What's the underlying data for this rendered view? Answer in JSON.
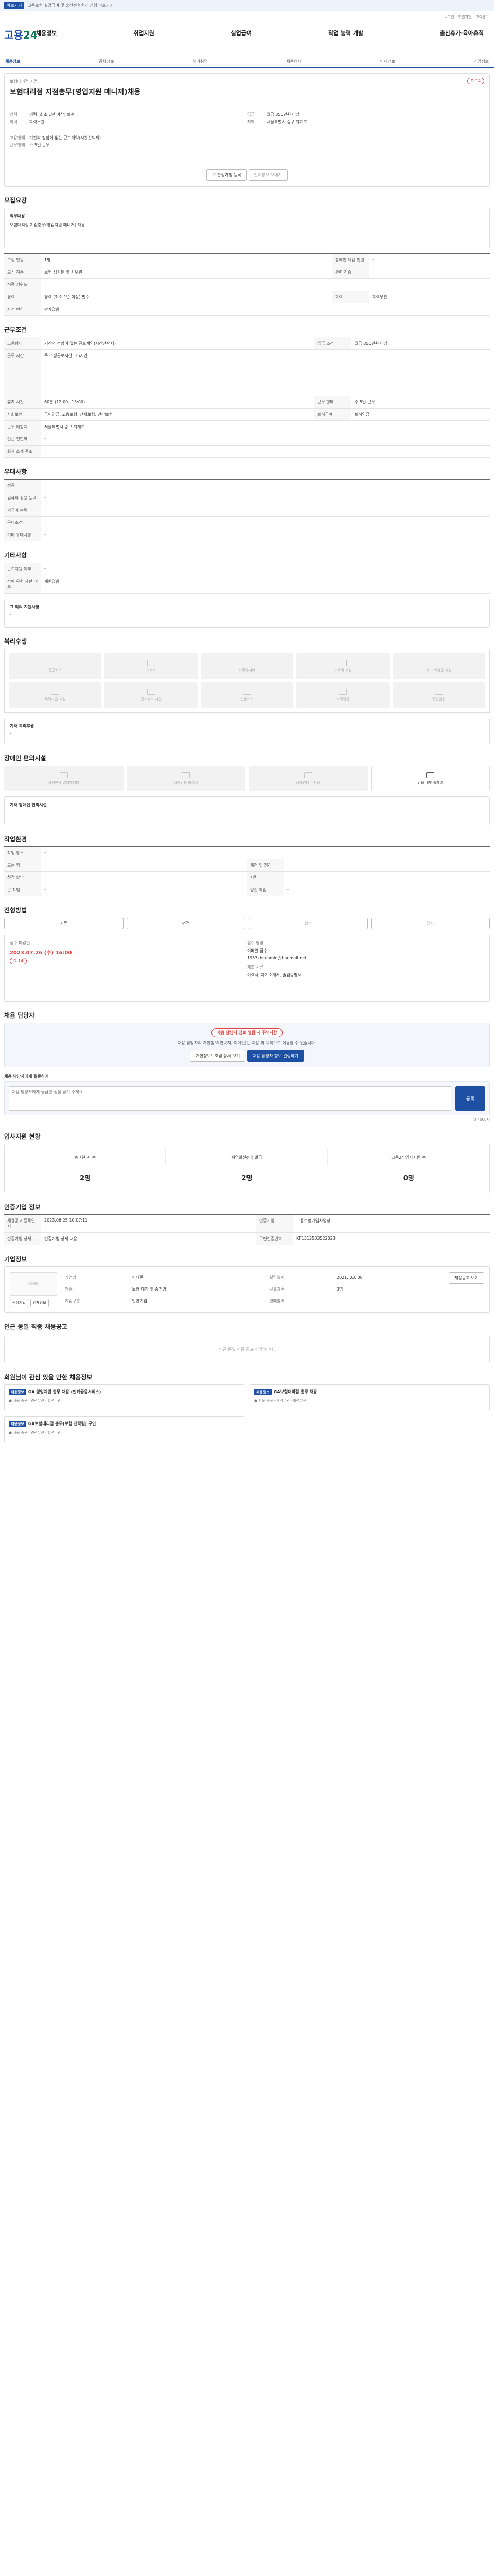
{
  "topbar": {
    "go": "바로가기",
    "text": "고용보험 실업급여 및 출산전후휴가 신청 바로가기"
  },
  "header": {
    "links": [
      "로그인",
      "회원가입",
      "고객센터"
    ],
    "logo_a": "고용",
    "logo_b": "24",
    "gnb": [
      "채용정보",
      "취업지원",
      "실업급여",
      "직업 능력 개발",
      "출산휴가·육아휴직"
    ]
  },
  "subtabs": [
    "채용정보",
    "공채정보",
    "해외취업",
    "채용행사",
    "인재정보",
    "기업정보"
  ],
  "job": {
    "company": "보험대리점 지점",
    "title": "보험대리점 지점충무(영업지원 매니저)채용",
    "dday": "D-14",
    "left": [
      [
        "경력",
        "경력 (최소 1년 이상) 필수"
      ],
      [
        "학력",
        "학력무관"
      ]
    ],
    "right": [
      [
        "임금",
        "월급 350만원 이상"
      ],
      [
        "지역",
        "서울특별시 중구 퇴계로"
      ]
    ],
    "left2": [
      [
        "고용형태",
        "기간의 정함이 없는 근로계약(시간선택제)"
      ],
      [
        "근무형태",
        "주 5일 근무"
      ]
    ],
    "buttons": [
      "관심기업 등록",
      "인재정보 보내기",
      "입사지원"
    ]
  },
  "sections": {
    "recruit": "모집요강",
    "conditions": "근무조건",
    "treatment": "우대사항",
    "others": "기타사항",
    "welfare": "복리후생",
    "disability": "장애인 편의시설",
    "workplace": "작업환경",
    "process": "전형방법",
    "manager": "채용 담당자",
    "applicants": "입사지원 현황",
    "company": "인증기업 정보",
    "companyinfo": "기업정보",
    "similar": "인근 동일 직종 채용공고",
    "favorites": "회원님이 관심 있을 만한 채용정보"
  },
  "recruit": {
    "desc_title": "직무내용",
    "desc": "보험대리점 지점충무(영업지원 매니저) 채용",
    "rows": [
      [
        "모집 인원",
        "1명",
        "장애인 채용 인원",
        "-"
      ],
      [
        "모집 직종",
        "보험 심사원 및 사무원",
        "관련 직종",
        "-"
      ],
      [
        "직종 키워드",
        "-",
        "",
        ""
      ],
      [
        "경력",
        "경력 (최소 1년 이상) 필수",
        "학력",
        "학력무관"
      ],
      [
        "자격 면허",
        "관계없음",
        "",
        ""
      ]
    ]
  },
  "conditions": {
    "rows": [
      [
        "고용형태",
        "기간의 정함이 없는 근로계약(시간선택제)",
        "임금 조건",
        "월급 350만원 이상"
      ],
      [
        "근무 시간",
        "주 소정근로시간: 35시간",
        "",
        ""
      ],
      [
        "휴게 시간",
        "60분 (12:00~13:00)",
        "근무 형태",
        "주 5일 근무"
      ],
      [
        "사회보험",
        "국민연금, 고용보험, 산재보험, 건강보험",
        "퇴직급여",
        "퇴직연금"
      ],
      [
        "근무 예정지",
        "서울특별시 중구 퇴계로",
        "",
        ""
      ],
      [
        "인근 전철역",
        "-",
        "",
        ""
      ],
      [
        "회사 소개 주소",
        "-",
        "",
        ""
      ]
    ]
  },
  "treatment": {
    "rows": [
      [
        "전공",
        "-"
      ],
      [
        "컴퓨터 활용 능력",
        "-"
      ],
      [
        "외국어 능력",
        "-"
      ],
      [
        "우대조건",
        "-"
      ],
      [
        "기타 우대사항",
        "-"
      ]
    ]
  },
  "others": {
    "rows": [
      [
        "근로지원 여부",
        "-"
      ],
      [
        "장애 유형 제한 여부",
        "제한없음"
      ]
    ],
    "etc_label": "그 외의 지원사항",
    "etc": "-"
  },
  "welfare": {
    "items": [
      "통근버스",
      "기숙사",
      "차량유지비",
      "교육비 지원",
      "자녀 학자금 지원",
      "주택자금 지원",
      "경조사비 지원",
      "인센티브",
      "퇴직연금",
      "건강검진"
    ],
    "etc_label": "기타 복리후생",
    "etc": "-"
  },
  "disability": {
    "items": [
      "장애인용 엘리베이터",
      "장애인용 화장실",
      "장애인용 주차장",
      "건물 내부 휠체어"
    ],
    "etc_label": "기타 장애인 편의시설",
    "etc": "-"
  },
  "workplace": {
    "rows": [
      [
        "작업 장소",
        "-",
        "",
        ""
      ],
      [
        "드는 힘",
        "-",
        "세척 및 정리",
        "-"
      ],
      [
        "청각 할당",
        "-",
        "시력",
        "-"
      ],
      [
        "손 작업",
        "-",
        "양손 작업",
        "-"
      ]
    ]
  },
  "process": {
    "steps": [
      "서류",
      "면접",
      "합격",
      "입사"
    ],
    "deadline_label": "접수 마감일",
    "deadline": "2023.07.26 (수) 16:00",
    "deadline_badge": "D-14",
    "method_label": "접수 방법",
    "method": "이메일 접수",
    "email": "1953kbsunmin@hanmail.net",
    "docs_label": "제출 서류",
    "docs": "이력서, 자기소개서, 졸업증명서"
  },
  "manager": {
    "warn": "채용 담당자 정보 열람 시 주의사항",
    "warn_desc": "채용 담당자의 개인정보(연락처, 이메일)는 채용 외 목적으로 이용할 수 없습니다.",
    "btn1": "개인정보보호법 상세 보기",
    "btn2": "채용 담당자 정보 열람하기",
    "qa_label": "채용 담당자에게 질문하기",
    "qa_placeholder": "채용 담당자에게 궁금한 점을 남겨 주세요.",
    "qa_count": "0 / 500자",
    "qa_btn": "등록"
  },
  "applicants": {
    "items": [
      [
        "총 지원자 수",
        "2명"
      ],
      [
        "취업알선(이) 발급",
        "2명"
      ],
      [
        "고용24 입사지원 수",
        "0명"
      ]
    ]
  },
  "company": {
    "rows": [
      [
        "채용공고 등록일시",
        "2023.06.25 10:07:11",
        "인증기업",
        "고용보험가입사업장"
      ],
      [
        "인증기업 상세",
        "인증기업 상세 내용",
        "구인인증번호",
        "KF1312503522023"
      ]
    ]
  },
  "companyinfo": {
    "rows": [
      [
        "기업명",
        "퍼니콘",
        "설립일자",
        "2021. 03. 08"
      ],
      [
        "업종",
        "보험 대리 및 중개업",
        "근로자수",
        "3명"
      ],
      [
        "기업구분",
        "일반기업",
        "연매출액",
        "-"
      ]
    ],
    "btns": [
      "관심기업",
      "인재정보",
      "채용공고 보기"
    ],
    "sites": "-"
  },
  "similar": {
    "empty": "인근 동일 직종 공고가 없습니다."
  },
  "favorites": [
    {
      "tag": "채용정보",
      "company": "GA 영업지원 총무 채용 (인카금융서비스)",
      "loc": "서울 중구",
      "tags": [
        "경력무관",
        "학력무관"
      ]
    },
    {
      "tag": "채용정보",
      "company": "GA보험대리점 총무 채용",
      "loc": "서울 중구",
      "tags": [
        "경력무관",
        "학력무관"
      ]
    },
    {
      "tag": "채용정보",
      "company": "GA보험대리점 총무(보험 전략팀) 구인",
      "loc": "서울 중구",
      "tags": [
        "경력무관",
        "학력무관"
      ]
    }
  ]
}
